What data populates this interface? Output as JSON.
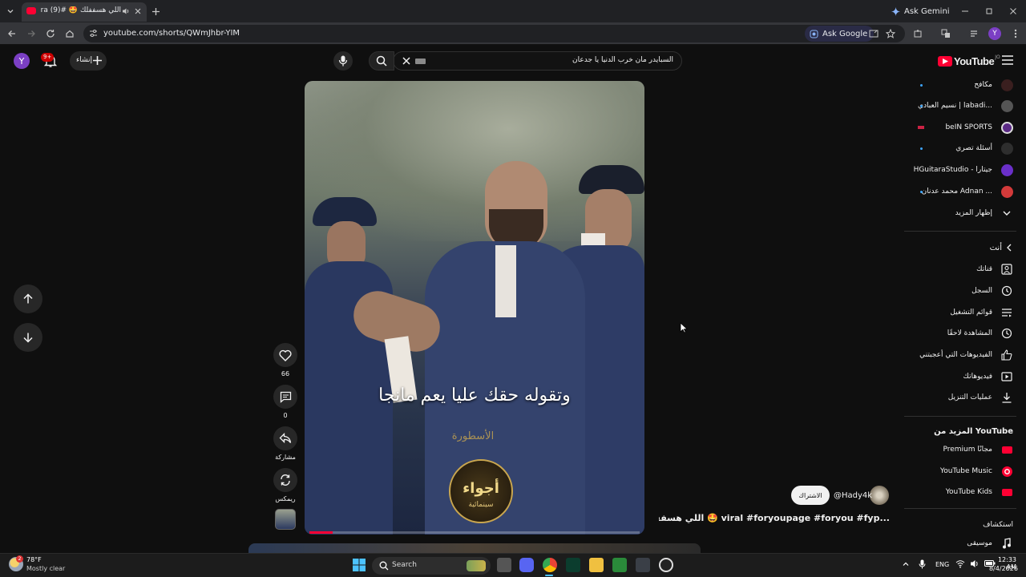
{
  "browser": {
    "tab_title": "اللي هسففلك 🤩 #vira (9)",
    "ask_gemini": "Ask Gemini",
    "url": "youtube.com/shorts/QWmJhbr-YIM",
    "ask_google": "Ask Google",
    "profile_letter": "Y"
  },
  "youtube": {
    "logo_text": "YouTube",
    "logo_region": "JO",
    "search_value": "السبايدر مان خرب الدنيا يا جدعان",
    "create_label": "إنشاء",
    "notif_count": "9+",
    "avatar_letter": "Y"
  },
  "sidebar": {
    "subscriptions": [
      {
        "label": "مكافح"
      },
      {
        "label": "نسيم العبادي | labadi..."
      },
      {
        "label": "beIN SPORTS"
      },
      {
        "label": "أسئلة تصري"
      },
      {
        "label": "HGuitaraStudio - جيتارا"
      },
      {
        "label": "محمد عدنان Adnan ..."
      }
    ],
    "show_more": "إظهار المزيد",
    "you_header": "أنت",
    "you_items": [
      {
        "label": "قناتك",
        "icon": "person-icon"
      },
      {
        "label": "السجل",
        "icon": "history-icon"
      },
      {
        "label": "قوائم التشغيل",
        "icon": "playlist-icon"
      },
      {
        "label": "المشاهدة لاحقًا",
        "icon": "clock-icon"
      },
      {
        "label": "الفيديوهات التي أعجبتني",
        "icon": "like-icon"
      },
      {
        "label": "فيديوهاتك",
        "icon": "video-icon"
      },
      {
        "label": "عمليات التنزيل",
        "icon": "download-icon"
      }
    ],
    "more_header": "المزيد من YouTube",
    "more_items": [
      {
        "label": "Premium مجانًا"
      },
      {
        "label": "YouTube Music"
      },
      {
        "label": "YouTube Kids"
      }
    ],
    "explore_header": "استكشاف",
    "explore_items": [
      {
        "label": "موسيقى"
      }
    ]
  },
  "video": {
    "subtitle": "وتقوله حقك عليا يعم مانجا",
    "watermark_top": "الأسطورة",
    "logo_text": "أجواء",
    "logo_sub": "سينمائية",
    "progress": 0.07
  },
  "actions": {
    "likes": "66",
    "comments": "0",
    "share": "مشاركة",
    "remix": "ريمكس"
  },
  "channel": {
    "handle": "@Hady4k",
    "subscribe": "الاشتراك",
    "title": "...viral #foryoupage #foryou #fyp 🤩 اللي هسففلك"
  },
  "taskbar": {
    "temp": "78°F",
    "weather": "Mostly clear",
    "weather_badge": "2",
    "search": "Search",
    "lang": "ENG",
    "time": "12:33 AM",
    "date": "8/4/2026"
  }
}
